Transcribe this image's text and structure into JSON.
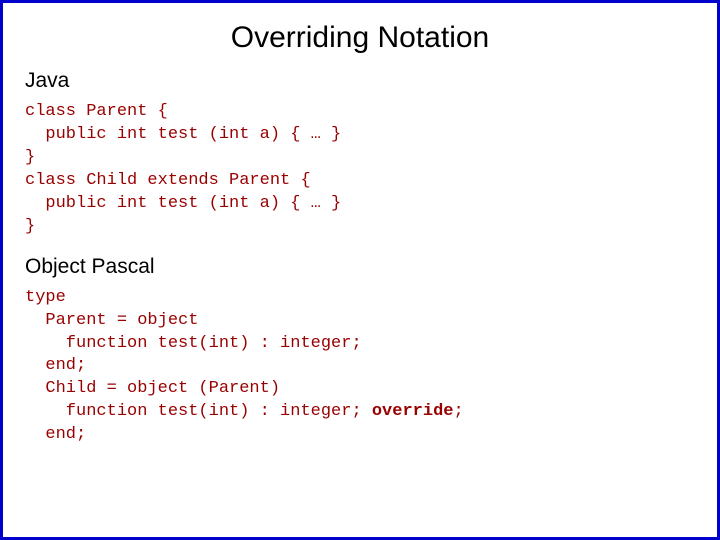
{
  "title": "Overriding Notation",
  "java": {
    "label": "Java",
    "code": "class Parent {\n  public int test (int a) { … }\n}\nclass Child extends Parent {\n  public int test (int a) { … }\n}"
  },
  "pascal": {
    "label": "Object Pascal",
    "line1": "type",
    "line2": "  Parent = object",
    "line3": "    function test(int) : integer;",
    "line4": "  end;",
    "line5": "  Child = object (Parent)",
    "line6_a": "    function test(int) : integer; ",
    "line6_override": "override",
    "line6_b": ";",
    "line7": "  end;"
  }
}
